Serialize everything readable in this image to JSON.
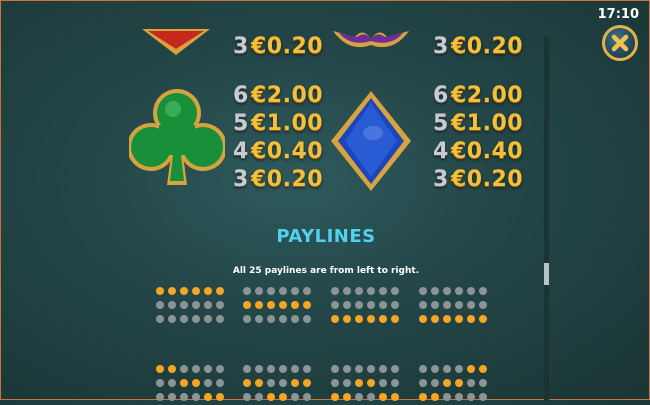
{
  "clock": "17:10",
  "close_button": {
    "icon": "close-x-icon",
    "accent": "#e1b24a"
  },
  "paytable": {
    "top_left": {
      "symbol": "red-diamond-symbol",
      "rows": [
        {
          "count": "3",
          "value": "€0.20"
        }
      ]
    },
    "top_right": {
      "symbol": "purple-spade-symbol",
      "rows": [
        {
          "count": "3",
          "value": "€0.20"
        }
      ]
    },
    "club": {
      "symbol": "green-club-symbol",
      "rows": [
        {
          "count": "6",
          "value": "€2.00"
        },
        {
          "count": "5",
          "value": "€1.00"
        },
        {
          "count": "4",
          "value": "€0.40"
        },
        {
          "count": "3",
          "value": "€0.20"
        }
      ]
    },
    "diamond": {
      "symbol": "blue-diamond-symbol",
      "rows": [
        {
          "count": "6",
          "value": "€2.00"
        },
        {
          "count": "5",
          "value": "€1.00"
        },
        {
          "count": "4",
          "value": "€0.40"
        },
        {
          "count": "3",
          "value": "€0.20"
        }
      ]
    }
  },
  "paylines_section": {
    "title": "PAYLINES",
    "subtitle": "All 25 paylines are from left to right.",
    "lines": [
      [
        1,
        1,
        1,
        1,
        1,
        1
      ],
      [
        0,
        0,
        0,
        0,
        0,
        0
      ],
      [
        0,
        0,
        0,
        0,
        0,
        0
      ],
      [
        0,
        0,
        0,
        0,
        0,
        0
      ],
      [
        1,
        1,
        1,
        1,
        1,
        1
      ],
      [
        0,
        0,
        0,
        0,
        0,
        0
      ],
      [
        0,
        0,
        0,
        0,
        0,
        0
      ],
      [
        0,
        0,
        0,
        0,
        0,
        0
      ],
      [
        1,
        1,
        1,
        1,
        1,
        1
      ],
      [
        0,
        0,
        0,
        0,
        0,
        0
      ],
      [
        0,
        0,
        0,
        0,
        0,
        0
      ],
      [
        1,
        1,
        1,
        1,
        1,
        1
      ]
    ],
    "line_row_2": [
      [
        [
          1,
          1,
          0,
          0,
          0,
          0
        ],
        [
          0,
          0,
          1,
          1,
          0,
          0
        ],
        [
          0,
          0,
          0,
          0,
          1,
          1
        ]
      ],
      [
        [
          0,
          0,
          0,
          0,
          0,
          0
        ],
        [
          1,
          1,
          0,
          0,
          1,
          1
        ],
        [
          0,
          0,
          1,
          1,
          0,
          0
        ]
      ],
      [
        [
          0,
          0,
          0,
          0,
          0,
          0
        ],
        [
          0,
          0,
          1,
          1,
          0,
          0
        ],
        [
          1,
          1,
          0,
          0,
          1,
          1
        ]
      ],
      [
        [
          0,
          0,
          0,
          0,
          1,
          1
        ],
        [
          0,
          0,
          1,
          1,
          0,
          0
        ],
        [
          1,
          1,
          0,
          0,
          0,
          0
        ]
      ]
    ],
    "colors": {
      "on": "#f5a623",
      "off": "#8b9596",
      "title": "#52d1ee"
    }
  }
}
